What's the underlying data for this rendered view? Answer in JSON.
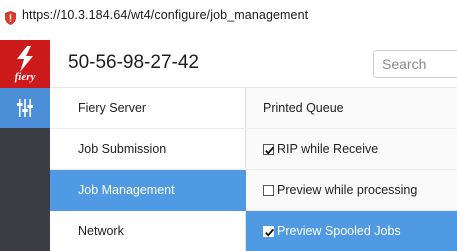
{
  "browser": {
    "url": "https://10.3.184.64/wt4/configure/job_management"
  },
  "header": {
    "logo_text": "fiery",
    "device_id": "50-56-98-27-42",
    "search_placeholder": "Search"
  },
  "colors": {
    "brand_red": "#cc1a1a",
    "accent_blue": "#4f9ae3",
    "rail_dark": "#3a3d43"
  },
  "menu": {
    "items": [
      {
        "label": "Fiery Server",
        "active": false
      },
      {
        "label": "Job Submission",
        "active": false
      },
      {
        "label": "Job Management",
        "active": true
      },
      {
        "label": "Network",
        "active": false
      }
    ]
  },
  "options": {
    "items": [
      {
        "label": "Printed Queue",
        "type": "section"
      },
      {
        "label": "RIP while Receive",
        "type": "checkbox",
        "checked": true
      },
      {
        "label": "Preview while processing",
        "type": "checkbox",
        "checked": false
      },
      {
        "label": "Preview Spooled Jobs",
        "type": "checkbox",
        "checked": true
      }
    ]
  },
  "icons": {
    "url_security": "warning-shield-icon",
    "rail_configure": "sliders-icon",
    "checkbox_check": "checkmark-icon"
  }
}
